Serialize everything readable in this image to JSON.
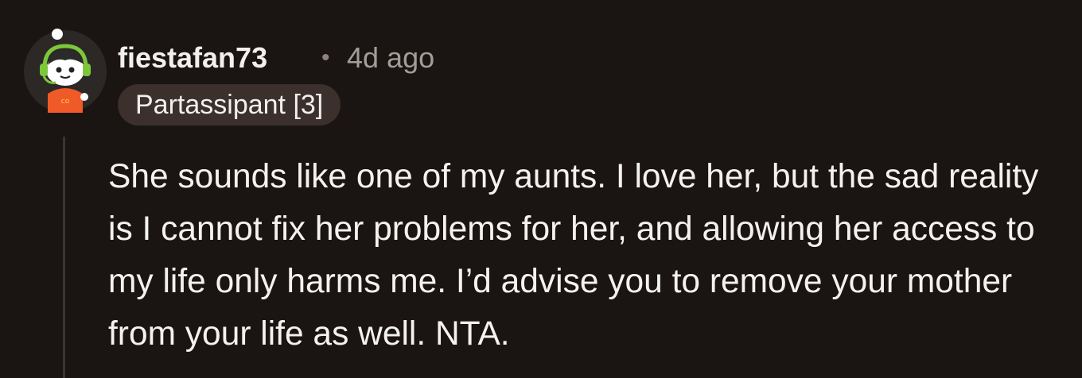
{
  "comment": {
    "username": "fiestafan73",
    "separator": "•",
    "timestamp": "4d ago",
    "flair": "Partassipant [3]",
    "body": "She sounds like one of my aunts. I love her, but the sad reality is I cannot fix her problems for her, and allowing her access to my life only harms me. I’d advise you to remove your mother from your life as well. NTA."
  },
  "avatar": {
    "icon": "snoo-avatar-icon",
    "headphone_color": "#7cc83a",
    "shirt_color": "#f05a28"
  }
}
